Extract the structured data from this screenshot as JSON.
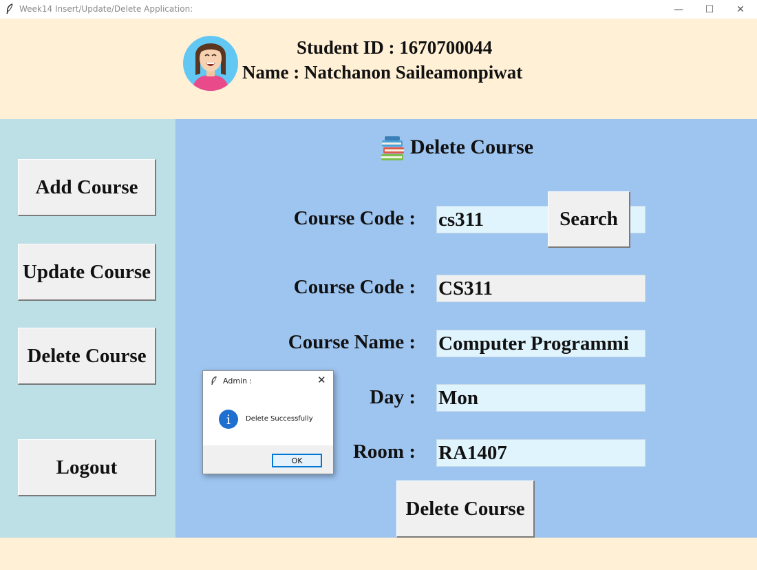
{
  "window": {
    "title": "Week14 Insert/Update/Delete Application:",
    "minimize": "—",
    "maximize": "☐",
    "close": "✕"
  },
  "header": {
    "student_id_line": "Student ID : 1670700044",
    "name_line": "Name : Natchanon Saileamonpiwat"
  },
  "sidebar": {
    "add": "Add Course",
    "update": "Update Course",
    "delete": "Delete Course",
    "logout": "Logout"
  },
  "main": {
    "heading": "Delete Course",
    "search_label": "Course Code :",
    "search_value": "cs311",
    "search_button": "Search",
    "fields": [
      {
        "label": "Course Code :",
        "value": "CS311"
      },
      {
        "label": "Course Name :",
        "value": "Computer Programmi"
      },
      {
        "label": "Day :",
        "value": "Mon"
      },
      {
        "label": "Room :",
        "value": "RA1407"
      }
    ],
    "delete_button": "Delete Course"
  },
  "dialog": {
    "title": "Admin :",
    "message": "Delete Successfully",
    "ok": "OK",
    "close": "✕",
    "info_icon": "i"
  },
  "colors": {
    "header_bg": "#fff0d6",
    "sidebar_bg": "#bddfe6",
    "main_bg": "#9ec5f0",
    "entry_bg": "#dff4fd",
    "button_bg": "#f0f0f0"
  }
}
